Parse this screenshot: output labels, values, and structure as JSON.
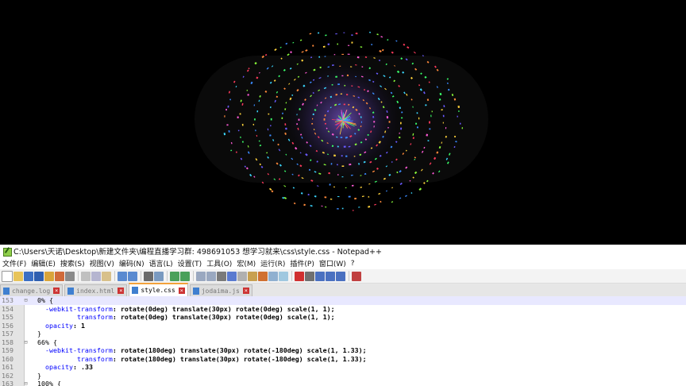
{
  "window": {
    "title": "C:\\Users\\天诺\\Desktop\\新建文件夹\\编程直播学习群: 498691053 想学习就来\\css\\style.css - Notepad++"
  },
  "menu": {
    "items": [
      "文件(F)",
      "编辑(E)",
      "搜索(S)",
      "视图(V)",
      "编码(N)",
      "语言(L)",
      "设置(T)",
      "工具(O)",
      "宏(M)",
      "运行(R)",
      "插件(P)",
      "窗口(W)",
      "?"
    ]
  },
  "tabs": [
    {
      "label": "change.log",
      "active": false
    },
    {
      "label": "index.html",
      "active": false
    },
    {
      "label": "style.css",
      "active": true
    },
    {
      "label": "jodaima.js",
      "active": false
    }
  ],
  "code": {
    "lines": [
      {
        "n": "153",
        "fold": "⊟",
        "parts": [
          [
            "txt",
            "  0% {"
          ]
        ]
      },
      {
        "n": "154",
        "fold": "",
        "parts": [
          [
            "p",
            "    -webkit-transform"
          ],
          [
            "punct",
            ":"
          ],
          [
            "v",
            " rotate(0deg) translate(30px) rotate(0deg) scale(1, 1);"
          ]
        ]
      },
      {
        "n": "155",
        "fold": "",
        "parts": [
          [
            "p",
            "            transform"
          ],
          [
            "punct",
            ":"
          ],
          [
            "v",
            " rotate(0deg) translate(30px) rotate(0deg) scale(1, 1);"
          ]
        ]
      },
      {
        "n": "156",
        "fold": "",
        "parts": [
          [
            "p",
            "    opacity"
          ],
          [
            "punct",
            ":"
          ],
          [
            "v",
            " 1"
          ]
        ]
      },
      {
        "n": "157",
        "fold": "",
        "parts": [
          [
            "txt",
            "  }"
          ]
        ]
      },
      {
        "n": "158",
        "fold": "⊟",
        "parts": [
          [
            "txt",
            "  66% {"
          ]
        ]
      },
      {
        "n": "159",
        "fold": "",
        "parts": [
          [
            "p",
            "    -webkit-transform"
          ],
          [
            "punct",
            ":"
          ],
          [
            "v",
            " rotate(180deg) translate(30px) rotate(-180deg) scale(1, 1.33);"
          ]
        ]
      },
      {
        "n": "160",
        "fold": "",
        "parts": [
          [
            "p",
            "            transform"
          ],
          [
            "punct",
            ":"
          ],
          [
            "v",
            " rotate(180deg) translate(30px) rotate(-180deg) scale(1, 1.33);"
          ]
        ]
      },
      {
        "n": "161",
        "fold": "",
        "parts": [
          [
            "p",
            "    opacity"
          ],
          [
            "punct",
            ":"
          ],
          [
            "v",
            " .33"
          ]
        ]
      },
      {
        "n": "162",
        "fold": "",
        "parts": [
          [
            "txt",
            "  }"
          ]
        ]
      },
      {
        "n": "163",
        "fold": "⊟",
        "parts": [
          [
            "txt",
            "  100% {"
          ]
        ]
      }
    ]
  },
  "colors": {
    "editor_bg": "#ffffff",
    "property": "#0000ff",
    "tab_accent": "#f3a23b"
  }
}
